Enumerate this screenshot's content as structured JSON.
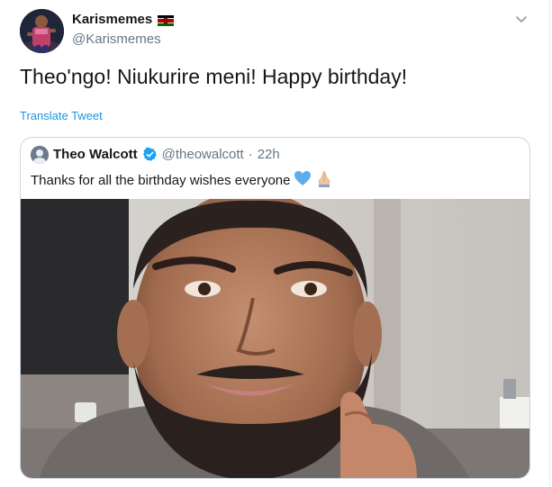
{
  "tweet": {
    "display_name": "Karismemes",
    "handle": "@Karismemes",
    "text": "Theo'ngo! Niukurire meni! Happy birthday!",
    "translate_label": "Translate Tweet",
    "flag_icon": "kenya-flag-icon",
    "menu_icon": "chevron-down-icon"
  },
  "quoted": {
    "display_name": "Theo Walcott",
    "handle": "@theowalcott",
    "separator": "·",
    "time": "22h",
    "text": "Thanks for all the birthday wishes everyone",
    "emoji": [
      "blue-heart-icon",
      "folded-hands-icon"
    ],
    "verified_icon": "verified-badge-icon"
  },
  "colors": {
    "link": "#1b95e0",
    "secondary_text": "#657786",
    "verified": "#1da1f2",
    "border": "#ccd6dd"
  }
}
